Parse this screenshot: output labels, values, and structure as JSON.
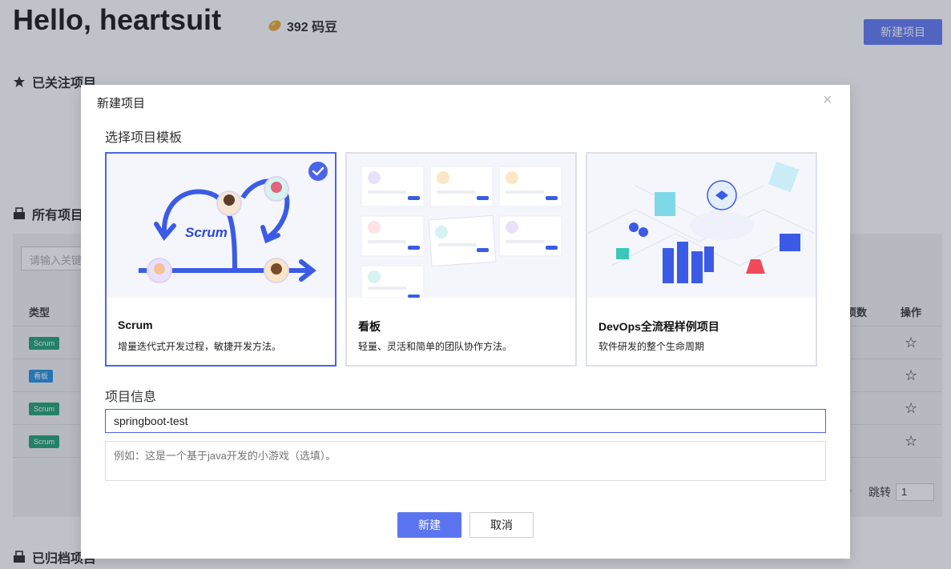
{
  "header": {
    "greeting": "Hello, heartsuit",
    "beans": "392 码豆",
    "new_project_label": "新建项目"
  },
  "sections": {
    "followed": "已关注项目",
    "all": "所有项目",
    "archived": "已归档项目"
  },
  "table": {
    "search_placeholder": "请输入关键字",
    "col_type": "类型",
    "col_count": "项数",
    "col_op": "操作",
    "rows": [
      {
        "type": "Scrum",
        "kind": "scrum"
      },
      {
        "type": "看板",
        "kind": "kanban"
      },
      {
        "type": "Scrum",
        "kind": "scrum"
      },
      {
        "type": "Scrum",
        "kind": "scrum"
      }
    ],
    "jump_label": "跳转",
    "jump_value": "1"
  },
  "modal": {
    "title": "新建项目",
    "template_heading": "选择项目模板",
    "templates": [
      {
        "name": "Scrum",
        "desc": "增量迭代式开发过程，敏捷开发方法。",
        "selected": true,
        "illus_text": "Scrum"
      },
      {
        "name": "看板",
        "desc": "轻量、灵活和简单的团队协作方法。",
        "selected": false
      },
      {
        "name": "DevOps全流程样例项目",
        "desc": "软件研发的整个生命周期",
        "selected": false
      }
    ],
    "info_heading": "项目信息",
    "name_value": "springboot-test",
    "desc_placeholder": "例如：这是一个基于java开发的小游戏（选填）。",
    "create_label": "新建",
    "cancel_label": "取消"
  },
  "colors": {
    "accent": "#4a65e8",
    "button": "#5b75f0",
    "scrum_tag": "#1aa06d",
    "kanban_tag": "#1a8fe0"
  }
}
